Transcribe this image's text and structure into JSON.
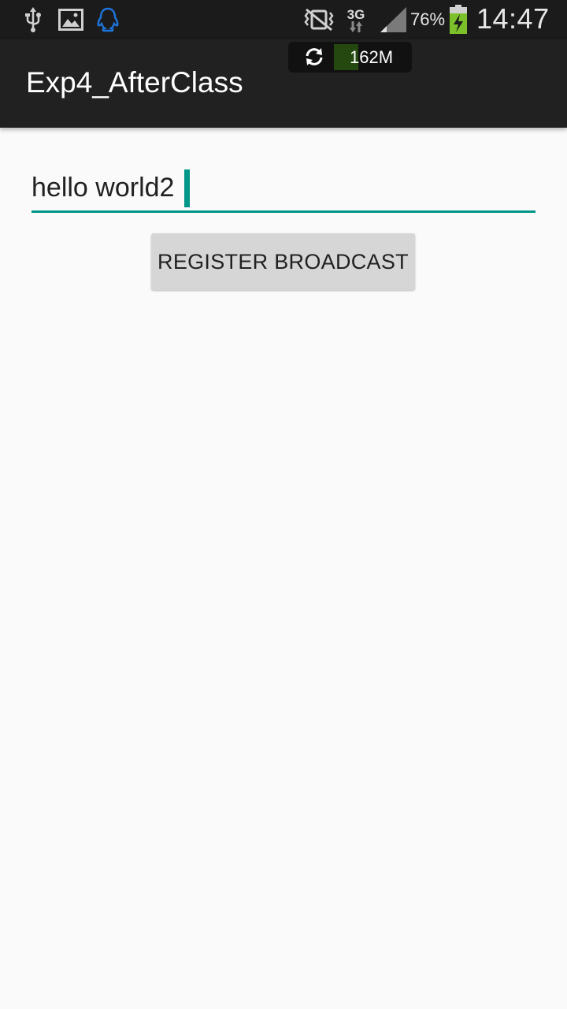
{
  "status_bar": {
    "icons": [
      "usb-icon",
      "gallery-icon",
      "qq-icon",
      "vibrate-off-icon",
      "network-3g-icon",
      "signal-icon",
      "battery-charging-icon"
    ],
    "network_type": "3G",
    "battery_percent": "76%",
    "time": "14:47"
  },
  "memory_overlay": {
    "value": "162M"
  },
  "app_bar": {
    "title": "Exp4_AfterClass"
  },
  "main": {
    "text_field_value": "hello world2",
    "register_button_label": "REGISTER BROADCAST"
  },
  "colors": {
    "status_bar_bg": "#1b1b1b",
    "app_bar_bg": "#212121",
    "accent": "#009688",
    "page_bg": "#fafafa",
    "button_bg": "#d6d6d6"
  }
}
